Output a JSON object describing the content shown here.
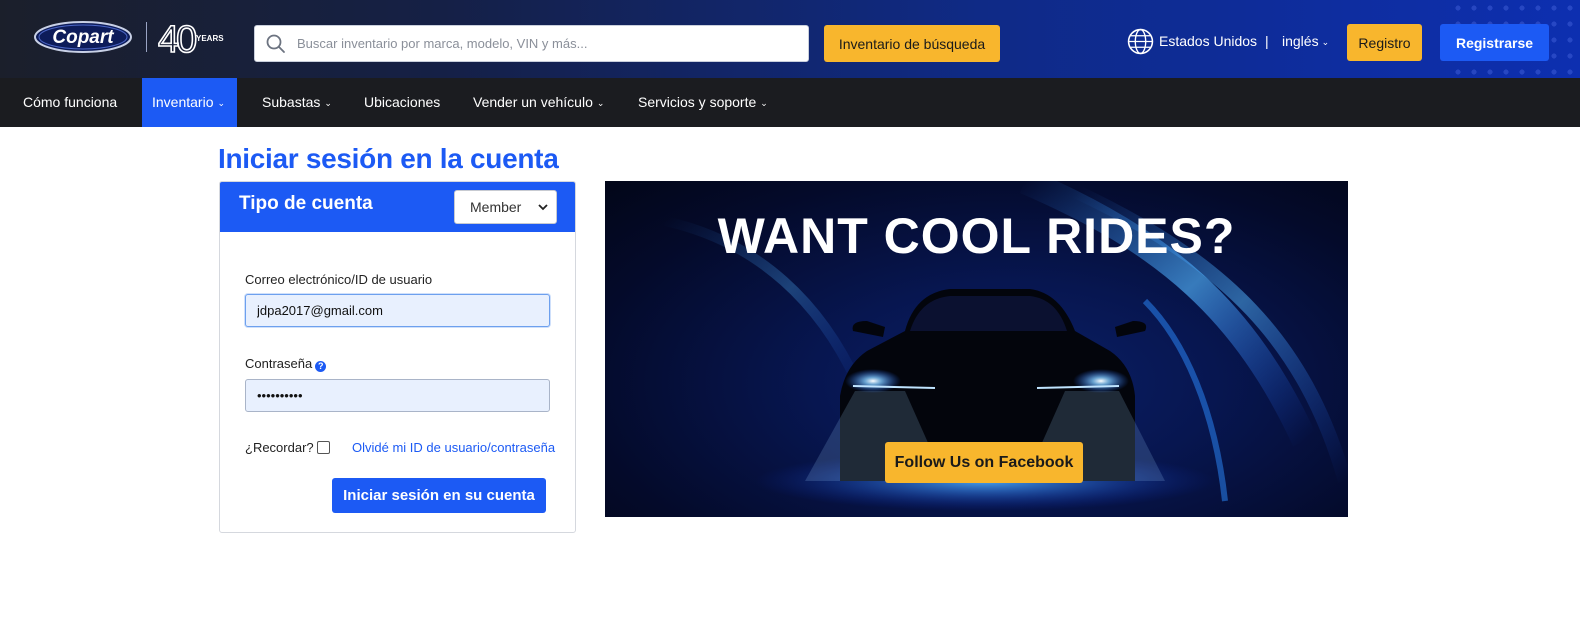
{
  "header": {
    "logo_text": "Copart",
    "logo_badge": "40",
    "logo_badge_sub": "YEARS",
    "search_placeholder": "Buscar inventario por marca, modelo, VIN y más...",
    "search_button": "Inventario de búsqueda",
    "country": "Estados Unidos",
    "separator": "|",
    "language": "inglés",
    "login_button": "Registro",
    "register_button": "Registrarse"
  },
  "nav": {
    "items": [
      {
        "label": "Cómo funciona",
        "dropdown": false
      },
      {
        "label": "Inventario",
        "dropdown": true,
        "active": true
      },
      {
        "label": "Subastas",
        "dropdown": true
      },
      {
        "label": "Ubicaciones",
        "dropdown": false
      },
      {
        "label": "Vender un vehículo",
        "dropdown": true
      },
      {
        "label": "Servicios y soporte",
        "dropdown": true
      }
    ],
    "chevron": "⌄"
  },
  "main": {
    "title": "Iniciar sesión en la cuenta",
    "panel": {
      "header_title": "Tipo de cuenta",
      "account_type": "Member",
      "email_label": "Correo electrónico/ID de usuario",
      "email_value": "jdpa2017@gmail.com",
      "password_label": "Contraseña",
      "password_value": "••••••••••",
      "help_glyph": "?",
      "remember_label": "¿Recordar?",
      "remember_checked": false,
      "forgot_link": "Olvidé mi ID de usuario/contraseña",
      "submit_button": "Iniciar sesión en su cuenta"
    },
    "banner": {
      "headline": "WANT COOL RIDES?",
      "cta_button": "Follow Us on Facebook"
    }
  },
  "colors": {
    "brand_blue": "#1c5af4",
    "accent_yellow": "#f8b62d",
    "nav_dark": "#1b1c20"
  }
}
